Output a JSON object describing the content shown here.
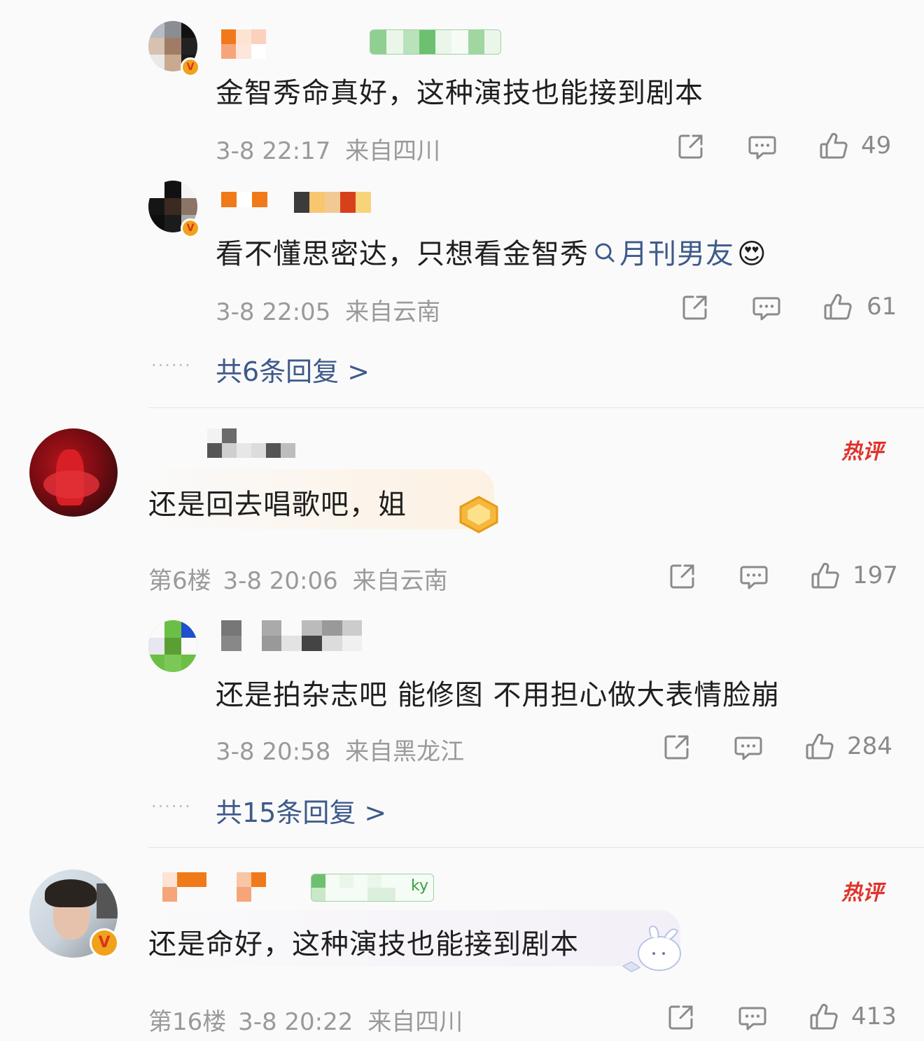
{
  "comments": [
    {
      "text": "金智秀命真好，这种演技也能接到剧本",
      "time": "3-8 22:17",
      "location": "来自四川",
      "likes": "49"
    },
    {
      "text_before_topic": "看不懂思密达，只想看金智秀",
      "topic": "月刊男友",
      "emoji": "😍",
      "time": "3-8 22:05",
      "location": "来自云南",
      "likes": "61"
    },
    {
      "replies_link": "共6条回复 >"
    },
    {
      "text": "还是回去唱歌吧，姐",
      "floor": "第6楼",
      "time": "3-8 20:06",
      "location": "来自云南",
      "likes": "197",
      "badge": "热评"
    },
    {
      "text": "还是拍杂志吧 能修图 不用担心做大表情脸崩",
      "time": "3-8 20:58",
      "location": "来自黑龙江",
      "likes": "284"
    },
    {
      "replies_link": "共15条回复 >"
    },
    {
      "text": "还是命好，这种演技也能接到剧本",
      "floor": "第16楼",
      "time": "3-8 20:22",
      "location": "来自四川",
      "likes": "413",
      "badge": "热评",
      "tag_tail": "ky"
    }
  ],
  "dots": "······",
  "icons": {
    "share": "share-icon",
    "comment": "comment-icon",
    "like": "thumbs-up-icon",
    "search": "search-icon",
    "verified": "verified-v-icon"
  },
  "colors": {
    "link": "#3e5a8a",
    "hot": "#e0332c",
    "meta": "#9a9a9a"
  },
  "verified_glyph": "V"
}
